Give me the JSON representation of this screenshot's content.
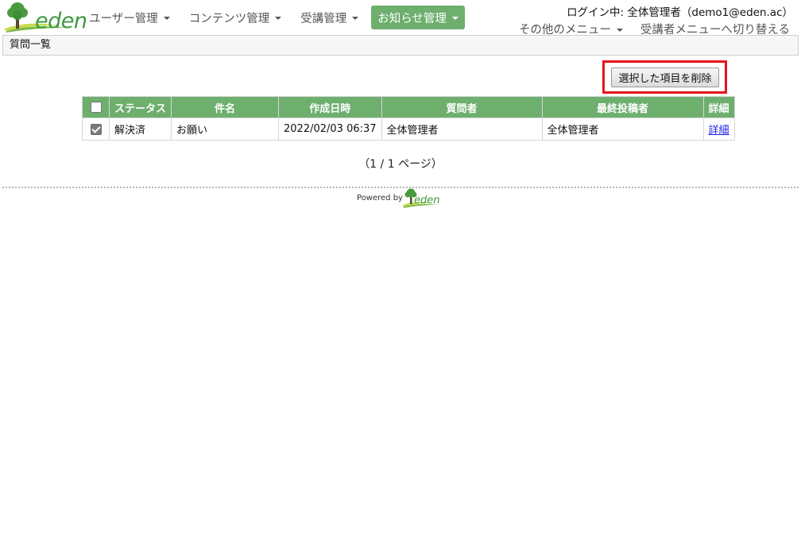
{
  "brand": {
    "logo_text": "eden",
    "green": "#3b9a41",
    "accent": "#6eaf6e",
    "highlight": "#e8141c"
  },
  "nav": {
    "items": [
      {
        "label": "ユーザー管理",
        "active": false
      },
      {
        "label": "コンテンツ管理",
        "active": false
      },
      {
        "label": "受講管理",
        "active": false
      },
      {
        "label": "お知らせ管理",
        "active": true
      }
    ]
  },
  "header": {
    "login_info": "ログイン中: 全体管理者（demo1@eden.ac）",
    "other_menu": "その他のメニュー",
    "switch_menu": "受講者メニューへ切り替える"
  },
  "breadcrumb": {
    "title": "質問一覧"
  },
  "actions": {
    "delete_selected": "選択した項目を削除"
  },
  "table": {
    "headers": {
      "status": "ステータス",
      "subject": "件名",
      "created": "作成日時",
      "asker": "質問者",
      "last_poster": "最終投稿者",
      "detail": "詳細"
    },
    "rows": [
      {
        "checked": true,
        "status": "解決済",
        "subject": "お願い",
        "created": "2022/02/03 06:37",
        "asker": "全体管理者",
        "last_poster": "全体管理者",
        "detail": "詳細"
      }
    ]
  },
  "pager": {
    "text": "（1 / 1 ページ）"
  },
  "footer": {
    "powered_by": "Powered by",
    "logo_text": "eden"
  }
}
